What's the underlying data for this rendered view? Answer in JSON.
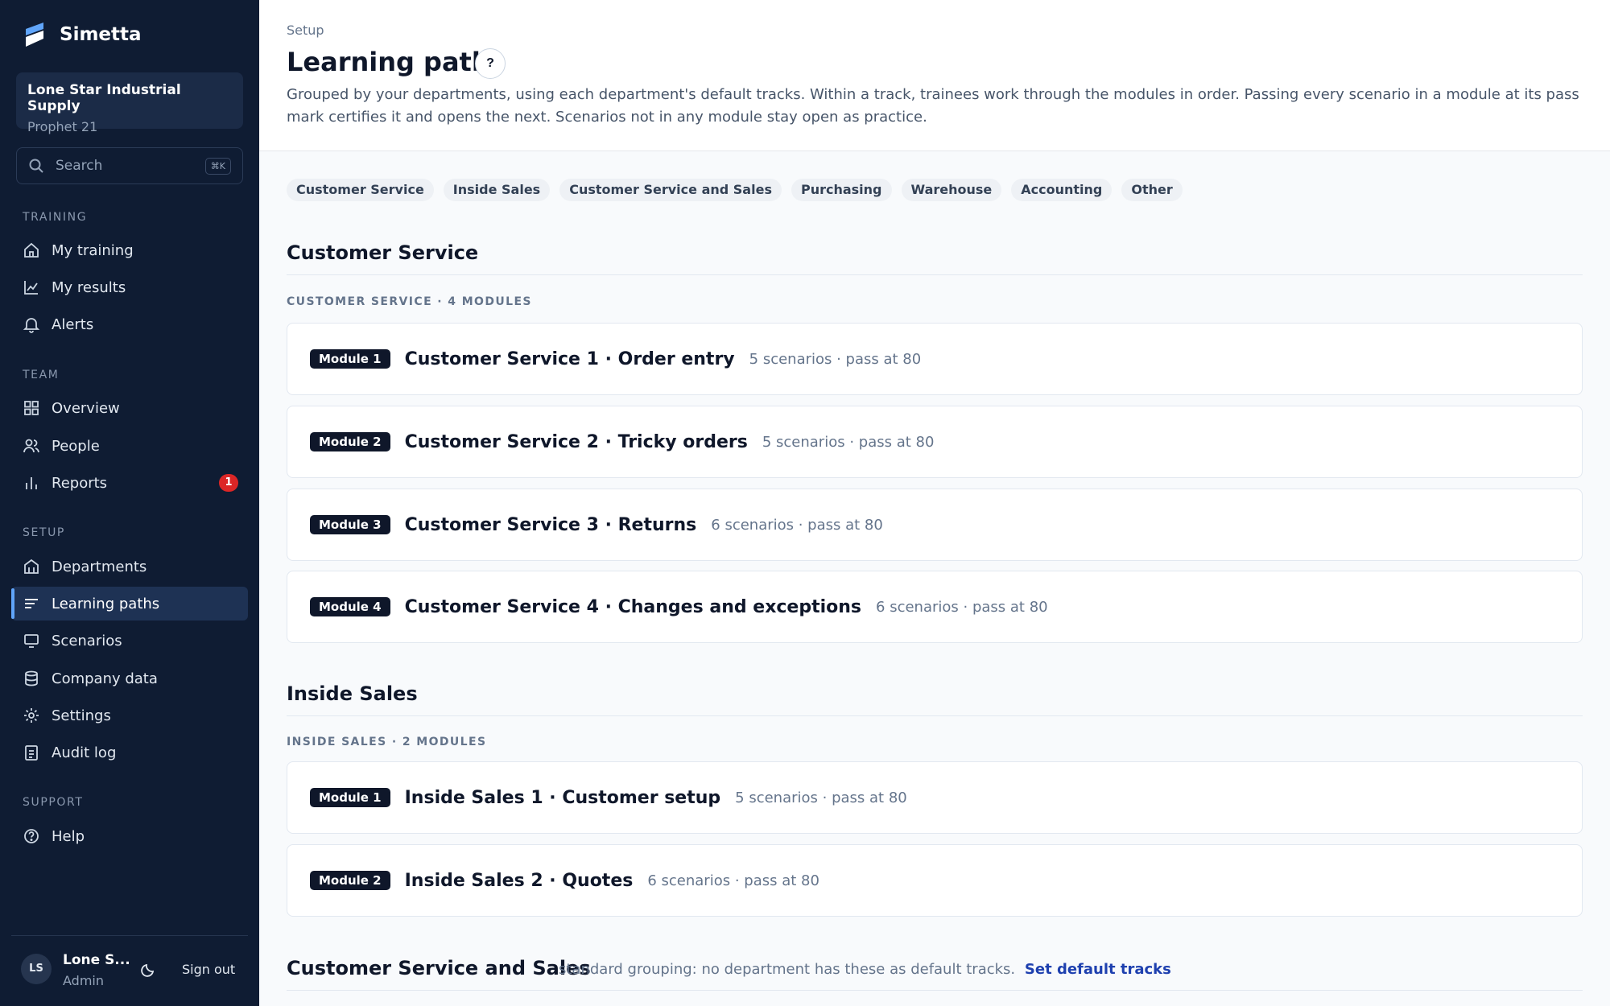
{
  "brand": {
    "name": "Simetta"
  },
  "org": {
    "name": "Lone Star Industrial Supply",
    "system": "Prophet 21"
  },
  "search": {
    "placeholder": "Search",
    "shortcut": "⌘K"
  },
  "nav": {
    "training": {
      "label": "TRAINING",
      "items": [
        {
          "label": "My training"
        },
        {
          "label": "My results"
        },
        {
          "label": "Alerts"
        }
      ]
    },
    "team": {
      "label": "TEAM",
      "items": [
        {
          "label": "Overview"
        },
        {
          "label": "People"
        },
        {
          "label": "Reports",
          "badge": "1"
        }
      ]
    },
    "setup": {
      "label": "SETUP",
      "items": [
        {
          "label": "Departments"
        },
        {
          "label": "Learning paths",
          "active": true
        },
        {
          "label": "Scenarios"
        },
        {
          "label": "Company data"
        },
        {
          "label": "Settings"
        },
        {
          "label": "Audit log"
        }
      ]
    },
    "support": {
      "label": "SUPPORT",
      "items": [
        {
          "label": "Help"
        }
      ]
    }
  },
  "user": {
    "initials": "LS",
    "name": "Lone S...",
    "role": "Admin",
    "sign_out": "Sign out"
  },
  "header": {
    "breadcrumb": "Setup",
    "title": "Learning paths",
    "help": "?",
    "description": "Grouped by your departments, using each department's default tracks. Within a track, trainees work through the modules in order. Passing every scenario in a module at its pass mark certifies it and opens the next. Scenarios not in any module stay open as practice."
  },
  "filters": [
    "Customer Service",
    "Inside Sales",
    "Customer Service and Sales",
    "Purchasing",
    "Warehouse",
    "Accounting",
    "Other"
  ],
  "sections": {
    "customer_service": {
      "title": "Customer Service",
      "track_label": "CUSTOMER SERVICE · 4 MODULES",
      "modules": [
        {
          "pill": "Module 1",
          "name": "Customer Service 1 · Order entry",
          "meta": "5 scenarios · pass at 80"
        },
        {
          "pill": "Module 2",
          "name": "Customer Service 2 · Tricky orders",
          "meta": "5 scenarios · pass at 80"
        },
        {
          "pill": "Module 3",
          "name": "Customer Service 3 · Returns",
          "meta": "6 scenarios · pass at 80"
        },
        {
          "pill": "Module 4",
          "name": "Customer Service 4 · Changes and exceptions",
          "meta": "6 scenarios · pass at 80"
        }
      ]
    },
    "inside_sales": {
      "title": "Inside Sales",
      "track_label": "INSIDE SALES · 2 MODULES",
      "modules": [
        {
          "pill": "Module 1",
          "name": "Inside Sales 1 · Customer setup",
          "meta": "5 scenarios · pass at 80"
        },
        {
          "pill": "Module 2",
          "name": "Inside Sales 2 · Quotes",
          "meta": "6 scenarios · pass at 80"
        }
      ]
    },
    "cs_and_sales": {
      "title": "Customer Service and Sales",
      "note": "standard grouping: no department has these as default tracks.",
      "link": "Set default tracks"
    }
  },
  "colors": {
    "sidebar": "#0f1c33",
    "accent": "#1e40af",
    "badge": "#dc2626",
    "pill": "#0f172a"
  }
}
